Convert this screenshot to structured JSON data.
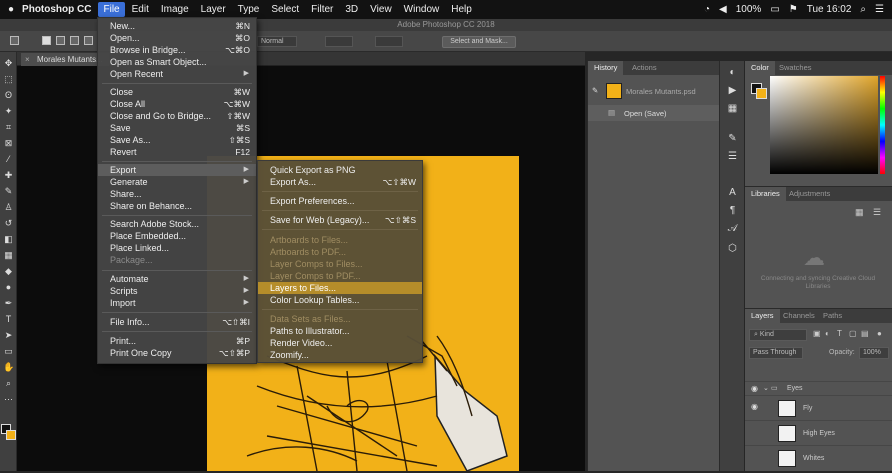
{
  "mac_menubar": {
    "app_name": "Photoshop CC",
    "menus": [
      "File",
      "Edit",
      "Image",
      "Layer",
      "Type",
      "Select",
      "Filter",
      "3D",
      "View",
      "Window",
      "Help"
    ],
    "battery": "100%",
    "clock": "Tue 16:02"
  },
  "window_title": "Adobe Photoshop CC 2018",
  "options_bar": {
    "style_value": "Normal",
    "select_mask_label": "Select and Mask..."
  },
  "document": {
    "tab_label": "Morales Mutants..."
  },
  "file_menu": {
    "items": [
      {
        "label": "New...",
        "shortcut": "⌘N"
      },
      {
        "label": "Open...",
        "shortcut": "⌘O"
      },
      {
        "label": "Browse in Bridge...",
        "shortcut": "⌥⌘O"
      },
      {
        "label": "Open as Smart Object...",
        "shortcut": ""
      },
      {
        "label": "Open Recent",
        "shortcut": ""
      },
      {
        "label": "Close",
        "shortcut": "⌘W"
      },
      {
        "label": "Close All",
        "shortcut": "⌥⌘W"
      },
      {
        "label": "Close and Go to Bridge...",
        "shortcut": "⇧⌘W"
      },
      {
        "label": "Save",
        "shortcut": "⌘S"
      },
      {
        "label": "Save As...",
        "shortcut": "⇧⌘S"
      },
      {
        "label": "Revert",
        "shortcut": "F12"
      },
      {
        "label": "Export",
        "shortcut": ""
      },
      {
        "label": "Generate",
        "shortcut": ""
      },
      {
        "label": "Share...",
        "shortcut": ""
      },
      {
        "label": "Share on Behance...",
        "shortcut": ""
      },
      {
        "label": "Search Adobe Stock...",
        "shortcut": ""
      },
      {
        "label": "Place Embedded...",
        "shortcut": ""
      },
      {
        "label": "Place Linked...",
        "shortcut": ""
      },
      {
        "label": "Package...",
        "shortcut": ""
      },
      {
        "label": "Automate",
        "shortcut": ""
      },
      {
        "label": "Scripts",
        "shortcut": ""
      },
      {
        "label": "Import",
        "shortcut": ""
      },
      {
        "label": "File Info...",
        "shortcut": "⌥⇧⌘I"
      },
      {
        "label": "Print...",
        "shortcut": "⌘P"
      },
      {
        "label": "Print One Copy",
        "shortcut": "⌥⇧⌘P"
      }
    ]
  },
  "export_submenu": {
    "items": [
      {
        "label": "Quick Export as PNG",
        "shortcut": ""
      },
      {
        "label": "Export As...",
        "shortcut": "⌥⇧⌘W"
      },
      {
        "label": "Export Preferences...",
        "shortcut": ""
      },
      {
        "label": "Save for Web (Legacy)...",
        "shortcut": "⌥⇧⌘S"
      },
      {
        "label": "Artboards to Files...",
        "shortcut": ""
      },
      {
        "label": "Artboards to PDF...",
        "shortcut": ""
      },
      {
        "label": "Layer Comps to Files...",
        "shortcut": ""
      },
      {
        "label": "Layer Comps to PDF...",
        "shortcut": ""
      },
      {
        "label": "Layers to Files...",
        "shortcut": ""
      },
      {
        "label": "Color Lookup Tables...",
        "shortcut": ""
      },
      {
        "label": "Data Sets as Files...",
        "shortcut": ""
      },
      {
        "label": "Paths to Illustrator...",
        "shortcut": ""
      },
      {
        "label": "Render Video...",
        "shortcut": ""
      },
      {
        "label": "Zoomify...",
        "shortcut": ""
      }
    ]
  },
  "history_panel": {
    "tabs": [
      "History",
      "Actions"
    ],
    "snapshot_label": "Morales Mutants.psd",
    "state_label": "Open (Save)"
  },
  "color_panel": {
    "tabs": [
      "Color",
      "Swatches"
    ]
  },
  "libraries_panel": {
    "tabs": [
      "Libraries",
      "Adjustments"
    ],
    "message": "Connecting and syncing Creative Cloud Libraries"
  },
  "layers_panel": {
    "tabs": [
      "Layers",
      "Channels",
      "Paths"
    ],
    "filter": "Kind",
    "blend_mode": "Pass Through",
    "opacity_label": "Opacity:",
    "opacity_value": "100%",
    "layers": [
      {
        "name": "Eyes"
      },
      {
        "name": "Fly"
      },
      {
        "name": "High Eyes"
      },
      {
        "name": "Whites"
      }
    ]
  },
  "colors": {
    "foreground": "#f2b118",
    "artboard": "#f2b118",
    "menu_highlight": "#3a6fd8"
  }
}
